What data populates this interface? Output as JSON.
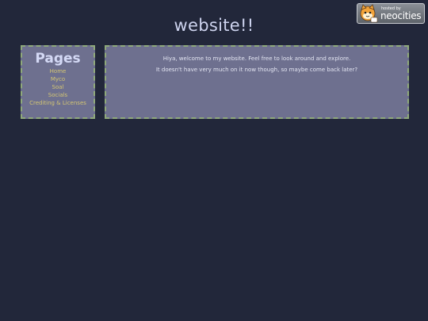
{
  "header": {
    "title": "website!!"
  },
  "badge": {
    "small_text": "hosted by",
    "big_text": "neocities",
    "icon": "neocities-cat-icon"
  },
  "sidebar": {
    "heading": "Pages",
    "items": [
      {
        "label": "Home"
      },
      {
        "label": "Myco"
      },
      {
        "label": "Soal"
      },
      {
        "label": "Socials"
      },
      {
        "label": "Crediting & Licenses"
      }
    ]
  },
  "main": {
    "paragraphs": [
      "Hiya, welcome to my website. Feel free to look around and explore.",
      "It doesn't have very much on it now though, so maybe come back later?"
    ]
  },
  "colors": {
    "background": "#22273a",
    "panel": "#6e708f",
    "panel_border": "#8fa97a",
    "link": "#d4c673",
    "title": "#cdd3ee"
  }
}
